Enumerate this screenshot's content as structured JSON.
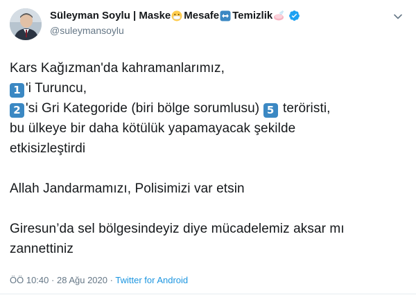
{
  "author": {
    "name": "Süleyman Soylu | Maske",
    "word2": "Mesafe",
    "word3": "Temizlik",
    "handle": "@suleymansoylu",
    "emojis": [
      "mask-face-emoji",
      "left-right-arrow-emoji",
      "soap-emoji"
    ],
    "verified": true
  },
  "tweet": {
    "line1": "Kars Kağızman'da kahramanlarımız,",
    "line2_num": "1",
    "line2_text": "'i Turuncu,",
    "line3_num": "2",
    "line3_text": "'si Gri Kategoride (biri bölge sorumlusu)",
    "line3_num2": "5",
    "line3_text2": "teröristi,",
    "line4": "bu ülkeye bir daha kötülük yapamayacak şekilde",
    "line5": "etkisizleştirdi",
    "line6": "Allah Jandarmamızı, Polisimizi var etsin",
    "line7": "Giresun’da sel bölgesindeyiz diye mücadelemiz aksar mı",
    "line8": "zannettiniz"
  },
  "meta": {
    "time": "ÖÖ 10:40",
    "separator": "·",
    "date": "28 Ağu 2020",
    "source": "Twitter for Android"
  },
  "colors": {
    "keycap": "#3b88c3",
    "link": "#1b95e0",
    "verified": "#1da1f2",
    "muted": "#657786"
  }
}
